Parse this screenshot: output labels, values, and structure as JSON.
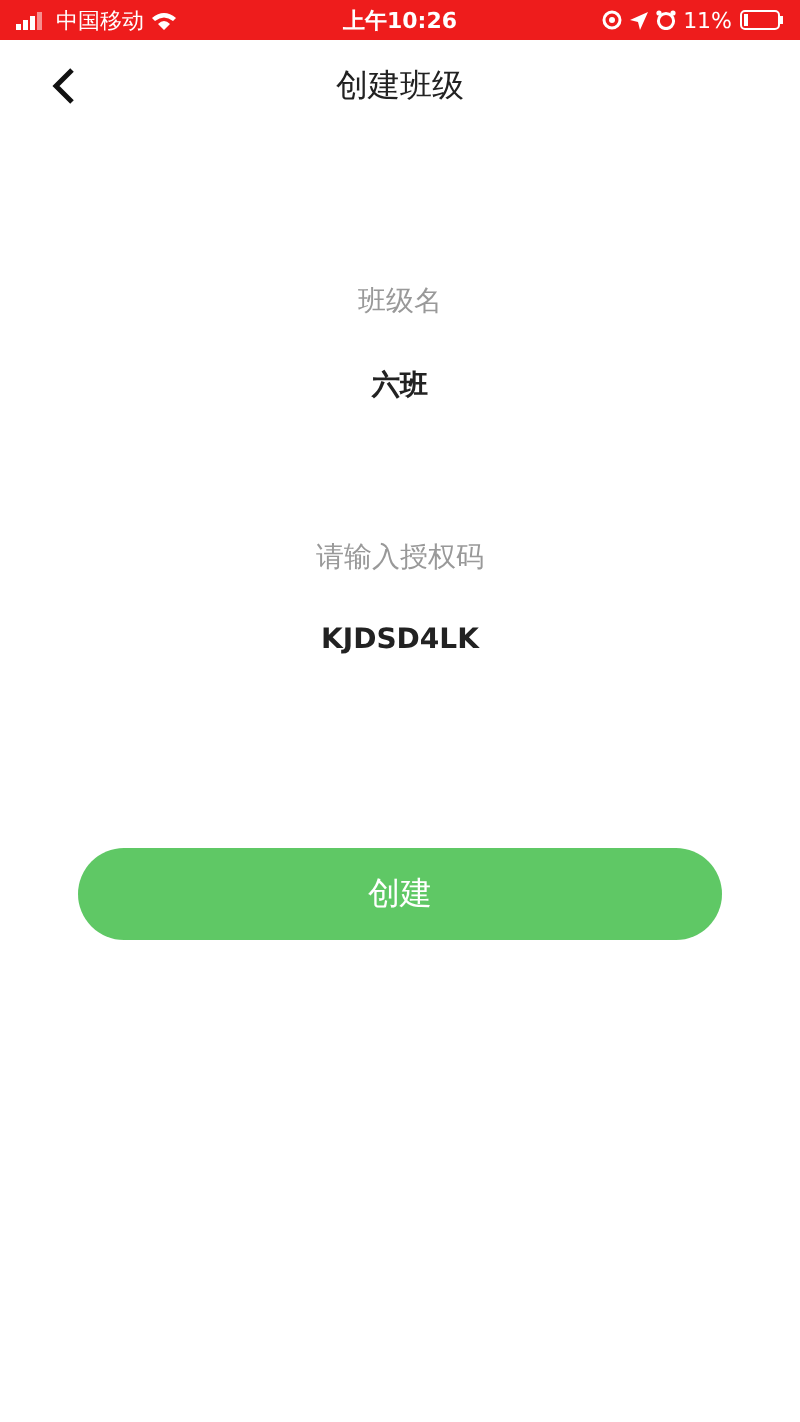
{
  "status_bar": {
    "carrier": "中国移动",
    "time": "上午10:26",
    "battery": "11%"
  },
  "nav_bar": {
    "title": "创建班级"
  },
  "fields": [
    {
      "label": "班级名",
      "value": "六班"
    },
    {
      "label": "请输入授权码",
      "value": "KJDSD4LK"
    }
  ],
  "button": {
    "label": "创建"
  }
}
